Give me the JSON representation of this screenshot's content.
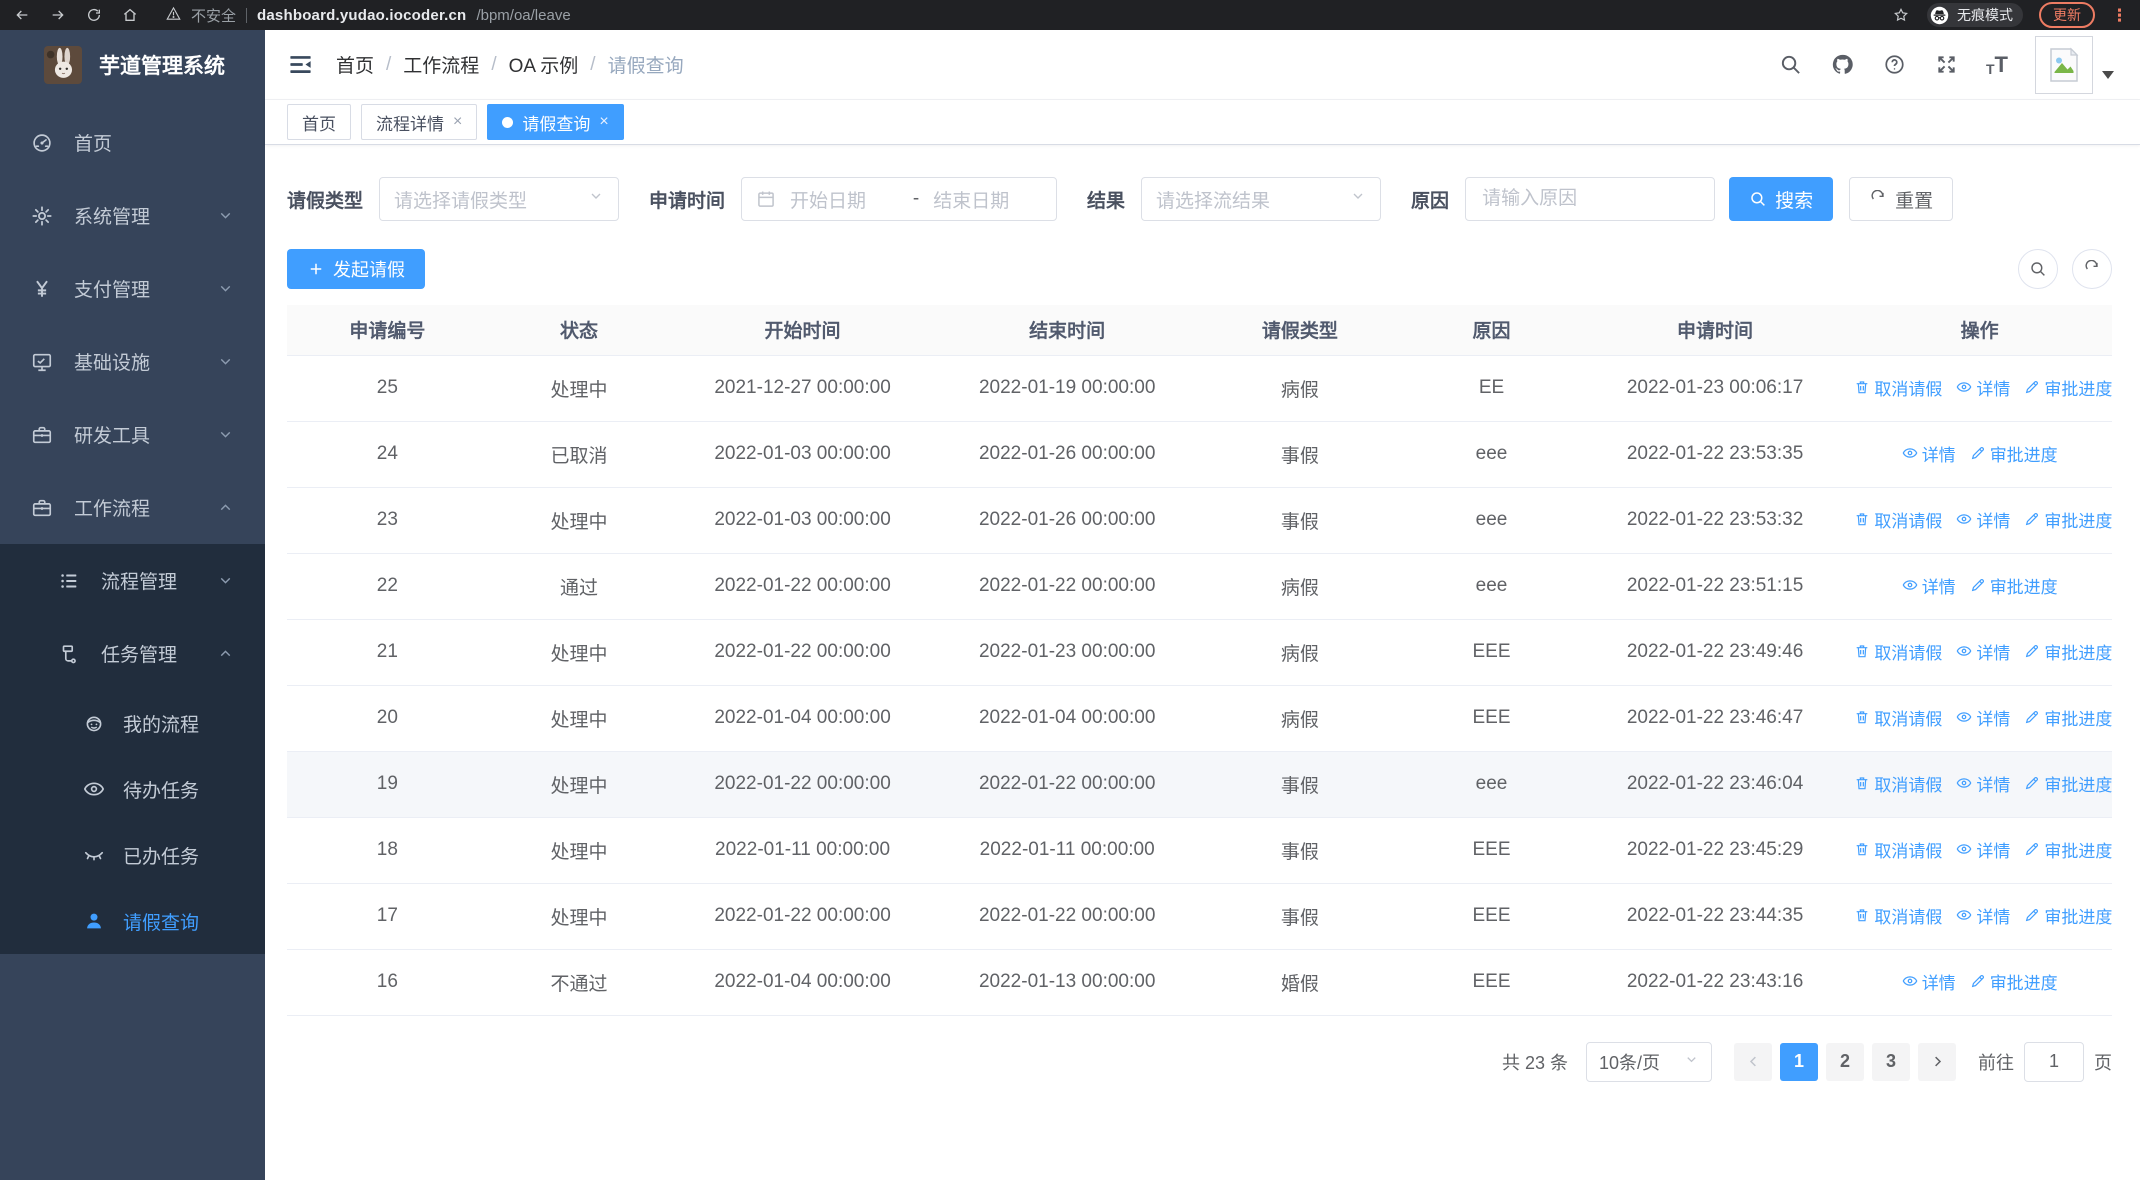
{
  "browser": {
    "security_label": "不安全",
    "url_host": "dashboard.yudao.iocoder.cn",
    "url_path": "/bpm/oa/leave",
    "incognito_label": "无痕模式",
    "update_label": "更新",
    "nav_icons": [
      "back",
      "forward",
      "reload",
      "home",
      "warning",
      "star",
      "incognito",
      "kebab-menu"
    ]
  },
  "sidebar": {
    "app_title": "芋道管理系统",
    "items": [
      {
        "name": "home",
        "label": "首页",
        "icon": "dashboard",
        "arrow": ""
      },
      {
        "name": "system",
        "label": "系统管理",
        "icon": "gear",
        "arrow": "down"
      },
      {
        "name": "payment",
        "label": "支付管理",
        "icon": "yen",
        "arrow": "down"
      },
      {
        "name": "infra",
        "label": "基础设施",
        "icon": "monitor",
        "arrow": "down"
      },
      {
        "name": "devtools",
        "label": "研发工具",
        "icon": "briefcase",
        "arrow": "down"
      },
      {
        "name": "workflow",
        "label": "工作流程",
        "icon": "briefcase",
        "arrow": "up"
      }
    ],
    "submenu": [
      {
        "name": "process-mgmt",
        "label": "流程管理",
        "icon": "listtree",
        "arrow": "down"
      },
      {
        "name": "task-mgmt",
        "label": "任务管理",
        "icon": "tasks",
        "arrow": "up"
      }
    ],
    "task_items": [
      {
        "name": "my-process",
        "label": "我的流程",
        "icon": "robot",
        "active": false
      },
      {
        "name": "todo-tasks",
        "label": "待办任务",
        "icon": "eye",
        "active": false
      },
      {
        "name": "done-tasks",
        "label": "已办任务",
        "icon": "eye-closed",
        "active": false
      },
      {
        "name": "leave-query",
        "label": "请假查询",
        "icon": "user",
        "active": true
      }
    ]
  },
  "header": {
    "breadcrumb": [
      "首页",
      "工作流程",
      "OA 示例",
      "请假查询"
    ]
  },
  "tabs": [
    {
      "name": "home",
      "label": "首页",
      "closable": false,
      "active": false
    },
    {
      "name": "process-detail",
      "label": "流程详情",
      "closable": true,
      "active": false
    },
    {
      "name": "leave-query",
      "label": "请假查询",
      "closable": true,
      "active": true
    }
  ],
  "filters": {
    "type_label": "请假类型",
    "type_placeholder": "请选择请假类型",
    "time_label": "申请时间",
    "time_start_placeholder": "开始日期",
    "time_separator": "-",
    "time_end_placeholder": "结束日期",
    "result_label": "结果",
    "result_placeholder": "请选择流结果",
    "reason_label": "原因",
    "reason_placeholder": "请输入原因",
    "search_label": "搜索",
    "reset_label": "重置"
  },
  "toolbar": {
    "create_label": "发起请假"
  },
  "table": {
    "columns": [
      "申请编号",
      "状态",
      "开始时间",
      "结束时间",
      "请假类型",
      "原因",
      "申请时间",
      "操作"
    ],
    "action_cancel": "取消请假",
    "action_detail": "详情",
    "action_progress": "审批进度",
    "rows": [
      {
        "id": "25",
        "status": "处理中",
        "start": "2021-12-27 00:00:00",
        "end": "2022-01-19 00:00:00",
        "type": "病假",
        "reason": "EE",
        "apply_time": "2022-01-23 00:06:17",
        "cancellable": true,
        "hover": false
      },
      {
        "id": "24",
        "status": "已取消",
        "start": "2022-01-03 00:00:00",
        "end": "2022-01-26 00:00:00",
        "type": "事假",
        "reason": "eee",
        "apply_time": "2022-01-22 23:53:35",
        "cancellable": false,
        "hover": false
      },
      {
        "id": "23",
        "status": "处理中",
        "start": "2022-01-03 00:00:00",
        "end": "2022-01-26 00:00:00",
        "type": "事假",
        "reason": "eee",
        "apply_time": "2022-01-22 23:53:32",
        "cancellable": true,
        "hover": false
      },
      {
        "id": "22",
        "status": "通过",
        "start": "2022-01-22 00:00:00",
        "end": "2022-01-22 00:00:00",
        "type": "病假",
        "reason": "eee",
        "apply_time": "2022-01-22 23:51:15",
        "cancellable": false,
        "hover": false
      },
      {
        "id": "21",
        "status": "处理中",
        "start": "2022-01-22 00:00:00",
        "end": "2022-01-23 00:00:00",
        "type": "病假",
        "reason": "EEE",
        "apply_time": "2022-01-22 23:49:46",
        "cancellable": true,
        "hover": false
      },
      {
        "id": "20",
        "status": "处理中",
        "start": "2022-01-04 00:00:00",
        "end": "2022-01-04 00:00:00",
        "type": "病假",
        "reason": "EEE",
        "apply_time": "2022-01-22 23:46:47",
        "cancellable": true,
        "hover": false
      },
      {
        "id": "19",
        "status": "处理中",
        "start": "2022-01-22 00:00:00",
        "end": "2022-01-22 00:00:00",
        "type": "事假",
        "reason": "eee",
        "apply_time": "2022-01-22 23:46:04",
        "cancellable": true,
        "hover": true
      },
      {
        "id": "18",
        "status": "处理中",
        "start": "2022-01-11 00:00:00",
        "end": "2022-01-11 00:00:00",
        "type": "事假",
        "reason": "EEE",
        "apply_time": "2022-01-22 23:45:29",
        "cancellable": true,
        "hover": false
      },
      {
        "id": "17",
        "status": "处理中",
        "start": "2022-01-22 00:00:00",
        "end": "2022-01-22 00:00:00",
        "type": "事假",
        "reason": "EEE",
        "apply_time": "2022-01-22 23:44:35",
        "cancellable": true,
        "hover": false
      },
      {
        "id": "16",
        "status": "不通过",
        "start": "2022-01-04 00:00:00",
        "end": "2022-01-13 00:00:00",
        "type": "婚假",
        "reason": "EEE",
        "apply_time": "2022-01-22 23:43:16",
        "cancellable": false,
        "hover": false
      }
    ]
  },
  "pagination": {
    "total_label": "共 23 条",
    "page_size_label": "10条/页",
    "pages": [
      "1",
      "2",
      "3"
    ],
    "active_page": "1",
    "goto_label": "前往",
    "goto_value": "1",
    "goto_suffix": "页"
  },
  "colors": {
    "primary": "#409eff",
    "sidebar_bg": "#36445a",
    "sidebar_submenu_bg": "#212d3d",
    "sidebar_text": "#c3cbd6",
    "update_accent": "#ee7c63",
    "table_border": "#ebeef5",
    "hover_row_bg": "#f5f7fa",
    "breadcrumb_muted": "#97a8be"
  }
}
